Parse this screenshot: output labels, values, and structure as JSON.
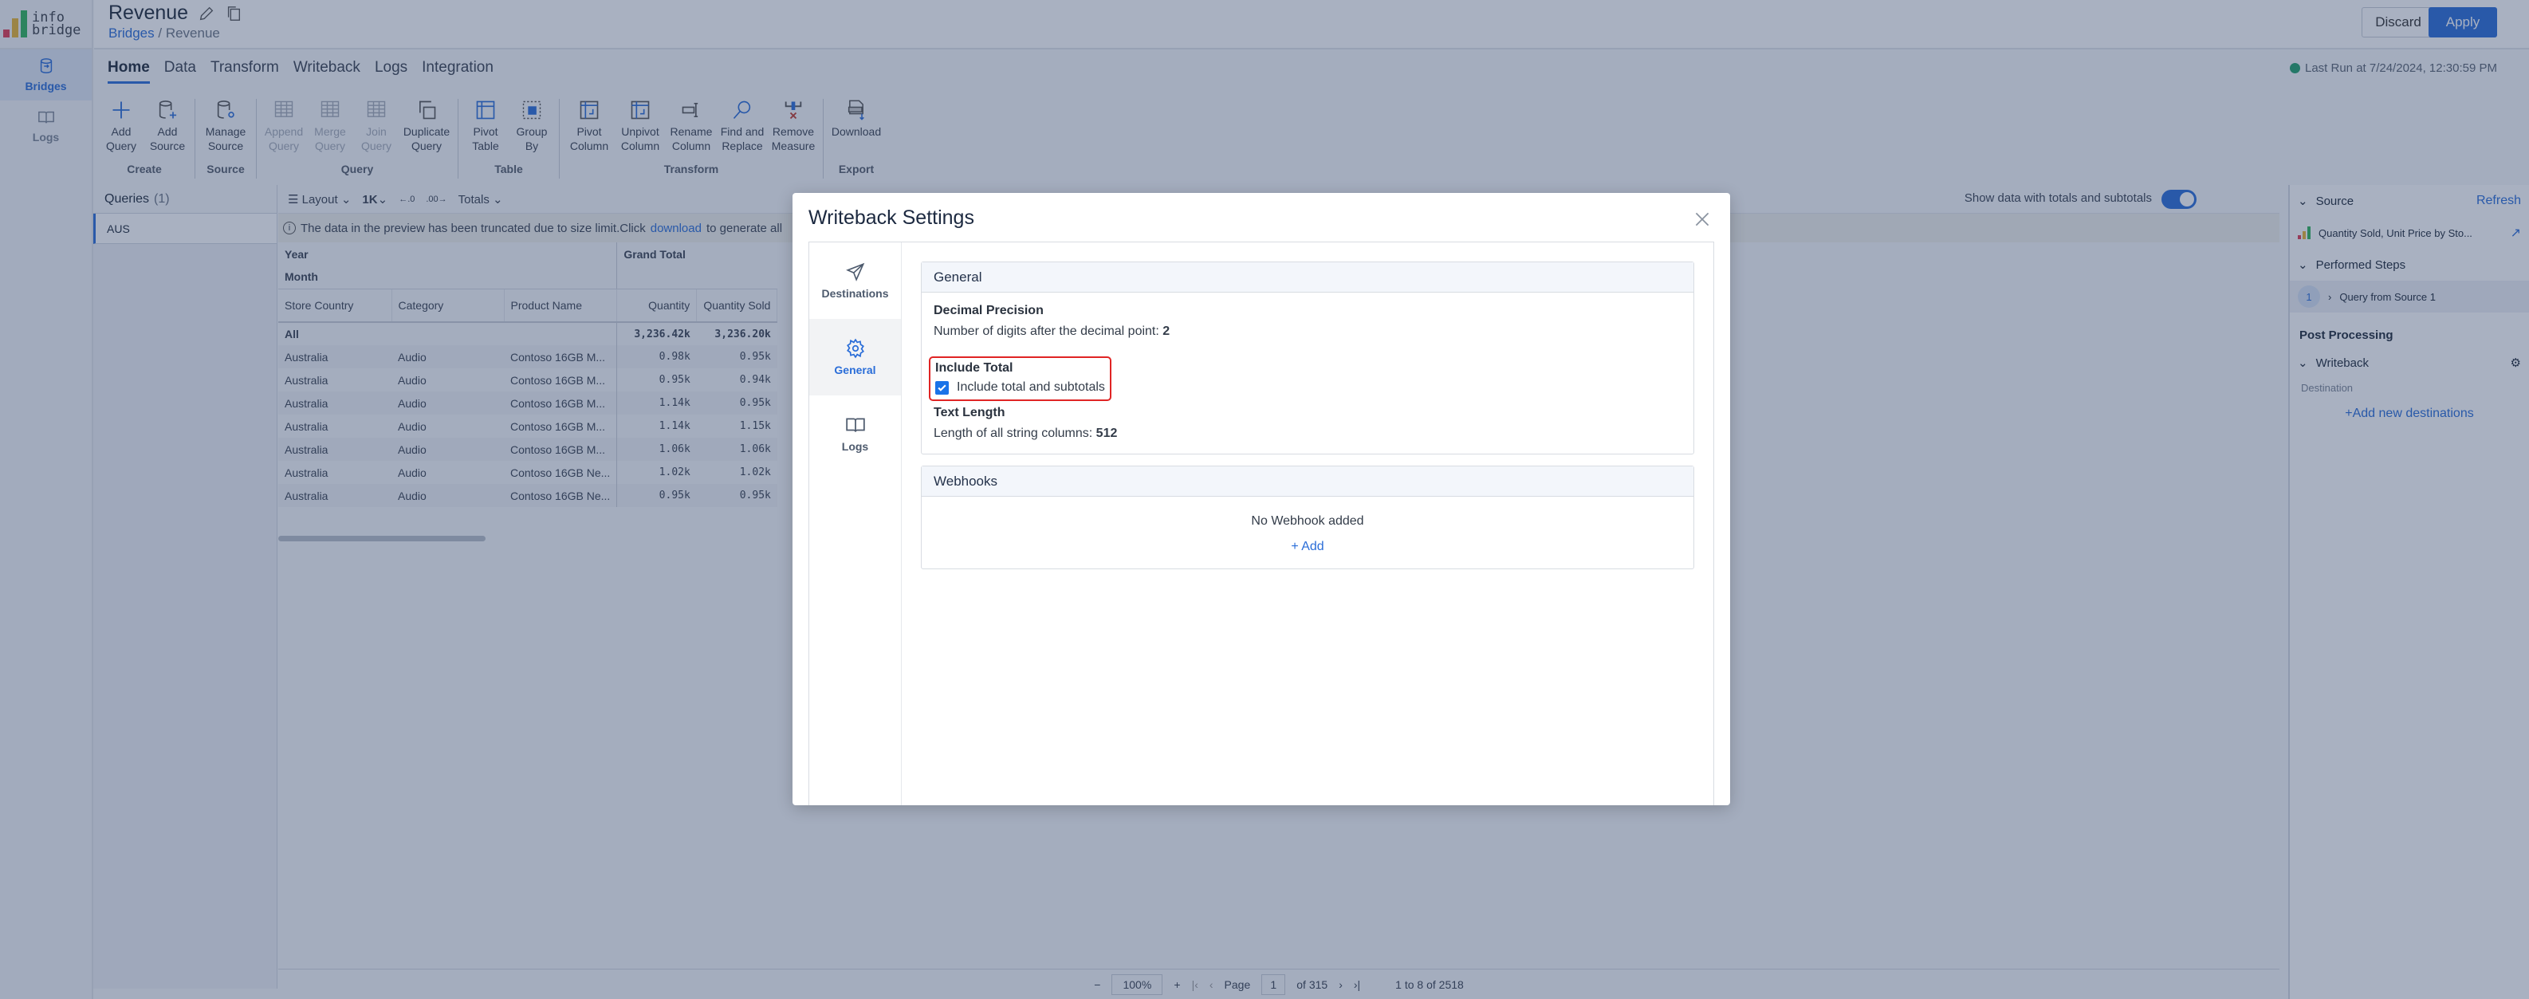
{
  "app": {
    "logo_text_line1": "info",
    "logo_text_line2": "bridge",
    "logo_colors": [
      "#e23b53",
      "#e8b533",
      "#2fb55a"
    ],
    "title": "Revenue",
    "breadcrumb": {
      "root": "Bridges",
      "current": "Revenue"
    },
    "discard_label": "Discard",
    "apply_label": "Apply",
    "last_run": "Last Run at 7/24/2024, 12:30:59 PM",
    "status_color": "#22a06b",
    "accent": "#2a6dd8"
  },
  "leftnav": {
    "items": [
      {
        "label": "Bridges",
        "icon": "bridge-icon",
        "active": true
      },
      {
        "label": "Logs",
        "icon": "book-icon",
        "active": false
      }
    ]
  },
  "tabs": [
    "Home",
    "Data",
    "Transform",
    "Writeback",
    "Logs",
    "Integration"
  ],
  "ribbon": {
    "groups": [
      {
        "label": "Create",
        "items": [
          {
            "l1": "Add",
            "l2": "Query",
            "disabled": false
          },
          {
            "l1": "Add",
            "l2": "Source",
            "disabled": false
          }
        ]
      },
      {
        "label": "Source",
        "items": [
          {
            "l1": "Manage",
            "l2": "Source",
            "disabled": false
          }
        ]
      },
      {
        "label": "Query",
        "items": [
          {
            "l1": "Append",
            "l2": "Query",
            "disabled": true
          },
          {
            "l1": "Merge",
            "l2": "Query",
            "disabled": true
          },
          {
            "l1": "Join",
            "l2": "Query",
            "disabled": true
          },
          {
            "l1": "Duplicate",
            "l2": "Query",
            "disabled": false
          }
        ]
      },
      {
        "label": "Table",
        "items": [
          {
            "l1": "Pivot",
            "l2": "Table",
            "disabled": false
          },
          {
            "l1": "Group",
            "l2": "By",
            "disabled": false
          }
        ]
      },
      {
        "label": "Transform",
        "items": [
          {
            "l1": "Pivot",
            "l2": "Column",
            "disabled": false
          },
          {
            "l1": "Unpivot",
            "l2": "Column",
            "disabled": false
          },
          {
            "l1": "Rename",
            "l2": "Column",
            "disabled": false
          },
          {
            "l1": "Find and",
            "l2": "Replace",
            "disabled": false
          },
          {
            "l1": "Remove",
            "l2": "Measure",
            "disabled": false
          }
        ]
      },
      {
        "label": "Export",
        "items": [
          {
            "l1": "Download",
            "l2": "",
            "disabled": false
          }
        ]
      }
    ]
  },
  "queries": {
    "label": "Queries",
    "count": "(1)",
    "items": [
      "AUS"
    ]
  },
  "grid": {
    "toolbar": {
      "layout": "Layout",
      "rows": "1K",
      "totals": "Totals",
      "toggle_label": "Show data with totals and subtotals",
      "toggle_on": true
    },
    "notice": {
      "before": "The data in the preview has been truncated due to size limit.Click ",
      "link": "download",
      "after": " to generate all"
    },
    "row_headers": [
      "Year",
      "Month"
    ],
    "grand_total": "Grand Total",
    "columns": [
      "Store Country",
      "Category",
      "Product Name",
      "Quantity",
      "Quantity Sold"
    ],
    "rows": [
      [
        "All",
        "",
        "",
        "3,236.42k",
        "3,236.20k"
      ],
      [
        "Australia",
        "Audio",
        "Contoso 16GB M...",
        "0.98k",
        "0.95k"
      ],
      [
        "Australia",
        "Audio",
        "Contoso 16GB M...",
        "0.95k",
        "0.94k"
      ],
      [
        "Australia",
        "Audio",
        "Contoso 16GB M...",
        "1.14k",
        "0.95k"
      ],
      [
        "Australia",
        "Audio",
        "Contoso 16GB M...",
        "1.14k",
        "1.15k"
      ],
      [
        "Australia",
        "Audio",
        "Contoso 16GB M...",
        "1.06k",
        "1.06k"
      ],
      [
        "Australia",
        "Audio",
        "Contoso 16GB Ne...",
        "1.02k",
        "1.02k"
      ],
      [
        "Australia",
        "Audio",
        "Contoso 16GB Ne...",
        "0.95k",
        "0.95k"
      ]
    ],
    "footer": {
      "zoom": "100%",
      "page_label": "Page",
      "page": "1",
      "of_pages": "of 315",
      "range": "1 to 8 of 2518"
    }
  },
  "right_panel": {
    "source_label": "Source",
    "refresh_label": "Refresh",
    "source_name": "Quantity Sold, Unit Price by Sto...",
    "steps_label": "Performed Steps",
    "steps": [
      {
        "num": "1",
        "label": "Query from Source 1"
      }
    ],
    "post_processing": "Post Processing",
    "writeback_label": "Writeback",
    "destination_label": "Destination",
    "add_destination": "+Add new destinations"
  },
  "modal": {
    "title": "Writeback Settings",
    "tabs": [
      {
        "label": "Destinations",
        "active": false
      },
      {
        "label": "General",
        "active": true
      },
      {
        "label": "Logs",
        "active": false
      }
    ],
    "general": {
      "header": "General",
      "decimal_title": "Decimal Precision",
      "decimal_text": "Number of digits after the decimal point: ",
      "decimal_value": "2",
      "total_title": "Include Total",
      "total_checkbox_label": "Include total and subtotals",
      "total_checked": true,
      "text_title": "Text Length",
      "text_text": "Length of all string columns: ",
      "text_value": "512"
    },
    "webhooks": {
      "header": "Webhooks",
      "empty": "No Webhook added",
      "add": "+ Add"
    }
  }
}
